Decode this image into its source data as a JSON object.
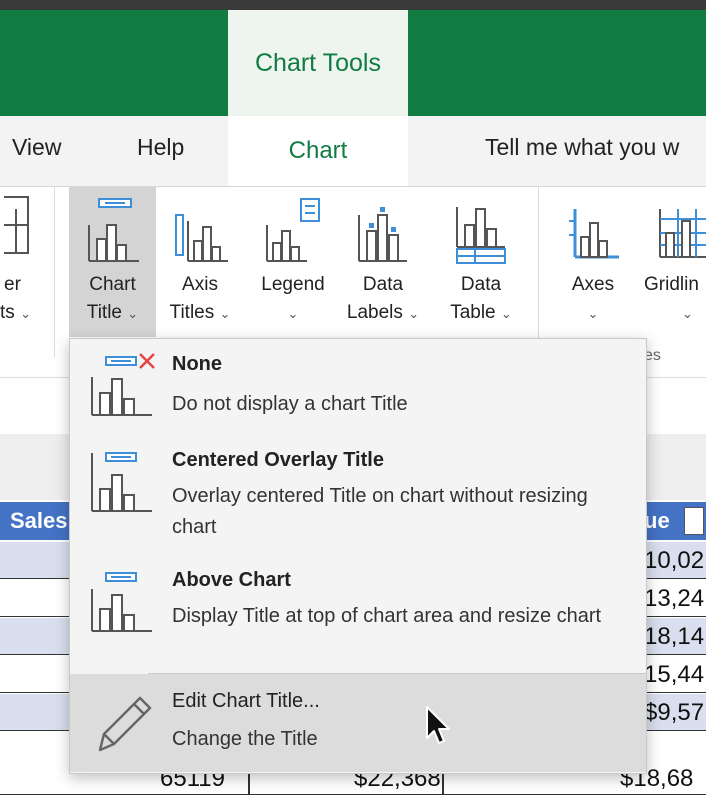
{
  "app": {
    "context_title": "Chart Tools"
  },
  "tabs": {
    "view": "View",
    "help": "Help",
    "chart": "Chart",
    "tell_me": "Tell me what you w"
  },
  "ribbon": {
    "buttons": [
      {
        "line1": "er",
        "line2": "ts"
      },
      {
        "line1": "Chart",
        "line2": "Title"
      },
      {
        "line1": "Axis",
        "line2": "Titles"
      },
      {
        "line1": "Legend",
        "line2": ""
      },
      {
        "line1": "Data",
        "line2": "Labels"
      },
      {
        "line1": "Data",
        "line2": "Table"
      },
      {
        "line1": "Axes",
        "line2": ""
      },
      {
        "line1": "Gridlin",
        "line2": ""
      }
    ],
    "group_label_partial": "es"
  },
  "menu": {
    "items": [
      {
        "title": "None",
        "desc": "Do not display a chart Title",
        "icon": "chart-title-none-icon"
      },
      {
        "title": "Centered Overlay Title",
        "desc": "Overlay centered Title on chart without resizing chart",
        "icon": "chart-title-overlay-icon"
      },
      {
        "title": "Above Chart",
        "desc": "Display Title at top of chart area and resize chart",
        "icon": "chart-title-above-icon"
      },
      {
        "title": "Edit Chart Title...",
        "desc": "Change the Title",
        "icon": "pencil-icon"
      }
    ]
  },
  "sheet": {
    "header_left": "Sales",
    "header_right": "ue",
    "right_values": [
      "10,02",
      "13,24",
      "18,14",
      "15,44",
      "$9,57",
      "$18,68"
    ],
    "last_row": {
      "col1": "65119",
      "col2": "$22,368"
    }
  },
  "colors": {
    "excel_green": "#107c41",
    "table_header_blue": "#4472c4",
    "row_shade": "#d9dfee",
    "icon_blue": "#3c8fd8",
    "none_x_red": "#e64545"
  }
}
